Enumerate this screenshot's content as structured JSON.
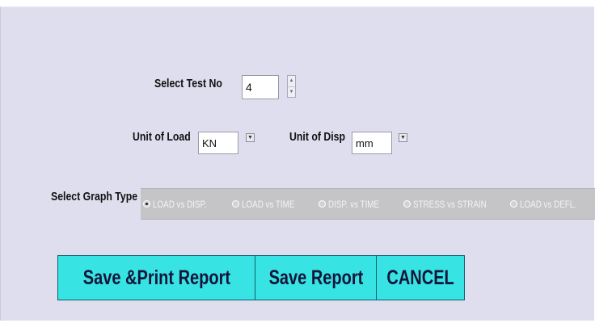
{
  "test_select": {
    "label": "Select Test No",
    "value": "4"
  },
  "load_unit": {
    "label": "Unit of Load",
    "value": "KN"
  },
  "disp_unit": {
    "label": "Unit of Disp",
    "value": "mm"
  },
  "graph_type": {
    "label": "Select Graph Type",
    "options": [
      {
        "label": "LOAD vs DISP.",
        "selected": true
      },
      {
        "label": "LOAD vs TIME",
        "selected": false
      },
      {
        "label": "DISP. vs TIME",
        "selected": false
      },
      {
        "label": "STRESS vs STRAIN",
        "selected": false
      },
      {
        "label": "LOAD vs DEFL.",
        "selected": false
      }
    ]
  },
  "actions": {
    "save_print": "Save &Print Report",
    "save": "Save Report",
    "cancel": "CANCEL"
  },
  "colors": {
    "panel_bg": "#dedeee",
    "button_bg": "#37e3e3",
    "graph_bar_bg": "#c5c5c7"
  },
  "icons": {
    "spinner": "up-down-spinner-icon",
    "dropdown": "dropdown-arrow-icon",
    "radio": "radio-icon"
  }
}
